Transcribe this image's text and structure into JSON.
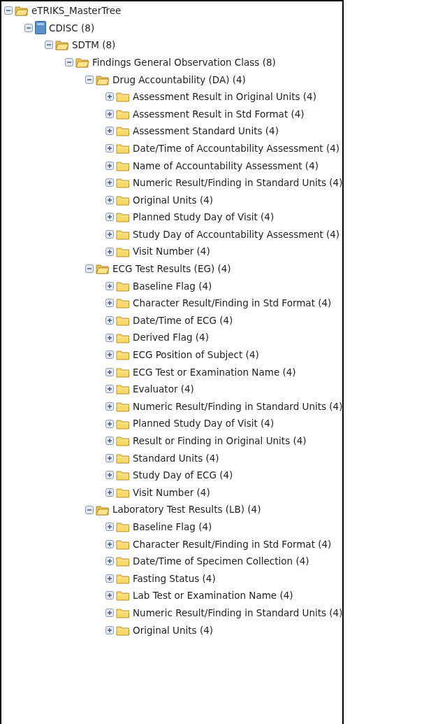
{
  "tree": [
    {
      "label": "eTRIKS_MasterTree",
      "kind": "folder",
      "expanded": true,
      "children": [
        {
          "label": "CDISC (8)",
          "kind": "study",
          "expanded": true,
          "children": [
            {
              "label": "SDTM (8)",
              "kind": "folder",
              "expanded": true,
              "children": [
                {
                  "label": "Findings General Observation Class (8)",
                  "kind": "folder",
                  "expanded": true,
                  "children": [
                    {
                      "label": "Drug Accountability (DA) (4)",
                      "kind": "folder",
                      "expanded": true,
                      "children": [
                        {
                          "label": "Assessment Result in Original Units (4)",
                          "kind": "folder",
                          "expanded": false
                        },
                        {
                          "label": "Assessment Result in Std Format (4)",
                          "kind": "folder",
                          "expanded": false
                        },
                        {
                          "label": "Assessment Standard Units (4)",
                          "kind": "folder",
                          "expanded": false
                        },
                        {
                          "label": "Date/Time of Accountability Assessment (4)",
                          "kind": "folder",
                          "expanded": false
                        },
                        {
                          "label": "Name of Accountability Assessment (4)",
                          "kind": "folder",
                          "expanded": false
                        },
                        {
                          "label": "Numeric Result/Finding in Standard Units (4)",
                          "kind": "folder",
                          "expanded": false
                        },
                        {
                          "label": "Original Units (4)",
                          "kind": "folder",
                          "expanded": false
                        },
                        {
                          "label": "Planned Study Day of Visit (4)",
                          "kind": "folder",
                          "expanded": false
                        },
                        {
                          "label": "Study Day of Accountability Assessment (4)",
                          "kind": "folder",
                          "expanded": false
                        },
                        {
                          "label": "Visit Number (4)",
                          "kind": "folder",
                          "expanded": false
                        }
                      ]
                    },
                    {
                      "label": "ECG Test Results (EG) (4)",
                      "kind": "folder",
                      "expanded": true,
                      "children": [
                        {
                          "label": "Baseline Flag (4)",
                          "kind": "folder",
                          "expanded": false
                        },
                        {
                          "label": "Character Result/Finding in Std Format (4)",
                          "kind": "folder",
                          "expanded": false
                        },
                        {
                          "label": "Date/Time of ECG (4)",
                          "kind": "folder",
                          "expanded": false
                        },
                        {
                          "label": "Derived Flag (4)",
                          "kind": "folder",
                          "expanded": false
                        },
                        {
                          "label": "ECG Position of Subject (4)",
                          "kind": "folder",
                          "expanded": false
                        },
                        {
                          "label": "ECG Test or Examination Name (4)",
                          "kind": "folder",
                          "expanded": false
                        },
                        {
                          "label": "Evaluator (4)",
                          "kind": "folder",
                          "expanded": false
                        },
                        {
                          "label": "Numeric Result/Finding in Standard Units (4)",
                          "kind": "folder",
                          "expanded": false
                        },
                        {
                          "label": "Planned Study Day of Visit (4)",
                          "kind": "folder",
                          "expanded": false
                        },
                        {
                          "label": "Result or Finding in Original Units (4)",
                          "kind": "folder",
                          "expanded": false
                        },
                        {
                          "label": "Standard Units (4)",
                          "kind": "folder",
                          "expanded": false
                        },
                        {
                          "label": "Study Day of ECG (4)",
                          "kind": "folder",
                          "expanded": false
                        },
                        {
                          "label": "Visit Number (4)",
                          "kind": "folder",
                          "expanded": false
                        }
                      ]
                    },
                    {
                      "label": "Laboratory Test Results (LB) (4)",
                      "kind": "folder",
                      "expanded": true,
                      "children": [
                        {
                          "label": "Baseline Flag (4)",
                          "kind": "folder",
                          "expanded": false
                        },
                        {
                          "label": "Character Result/Finding in Std Format (4)",
                          "kind": "folder",
                          "expanded": false
                        },
                        {
                          "label": "Date/Time of Specimen Collection (4)",
                          "kind": "folder",
                          "expanded": false
                        },
                        {
                          "label": "Fasting Status (4)",
                          "kind": "folder",
                          "expanded": false
                        },
                        {
                          "label": "Lab Test or Examination Name (4)",
                          "kind": "folder",
                          "expanded": false
                        },
                        {
                          "label": "Numeric Result/Finding in Standard Units (4)",
                          "kind": "folder",
                          "expanded": false
                        },
                        {
                          "label": "Original Units (4)",
                          "kind": "folder",
                          "expanded": false
                        }
                      ]
                    }
                  ]
                }
              ]
            }
          ]
        }
      ]
    }
  ]
}
